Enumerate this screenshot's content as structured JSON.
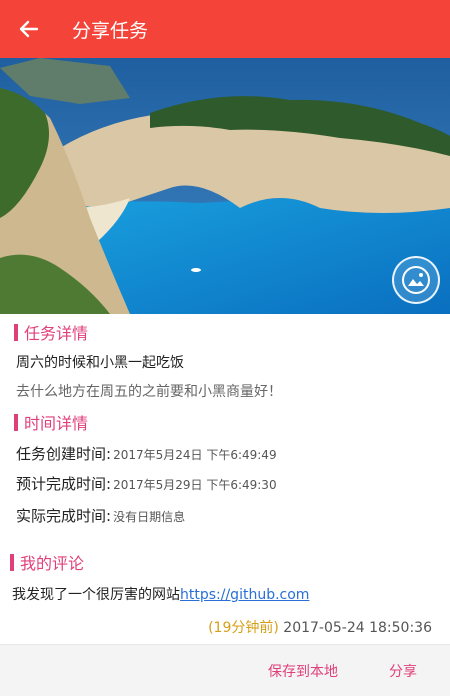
{
  "appbar": {
    "title": "分享任务"
  },
  "task_section": {
    "heading": "任务详情",
    "title": "周六的时候和小黑一起吃饭",
    "desc": "去什么地方在周五的之前要和小黑商量好！"
  },
  "time_section": {
    "heading": "时间详情",
    "created_label": "任务创建时间:",
    "created_value": "2017年5月24日 下午6:49:49",
    "planned_label": "预计完成时间:",
    "planned_value": "2017年5月29日 下午6:49:30",
    "actual_label": "实际完成时间:",
    "actual_value": "没有日期信息"
  },
  "comment_section": {
    "heading": "我的评论",
    "text": "我发现了一个很厉害的网站",
    "link": "https://github.com",
    "relative_time": "(19分钟前)",
    "timestamp": "2017-05-24 18:50:36"
  },
  "actions": {
    "save_label": "保存到本地",
    "share_label": "分享"
  },
  "colors": {
    "appbar": "#f4443a",
    "accent": "#e0407a",
    "link": "#2a6fd6",
    "relative_time": "#d4a017"
  }
}
